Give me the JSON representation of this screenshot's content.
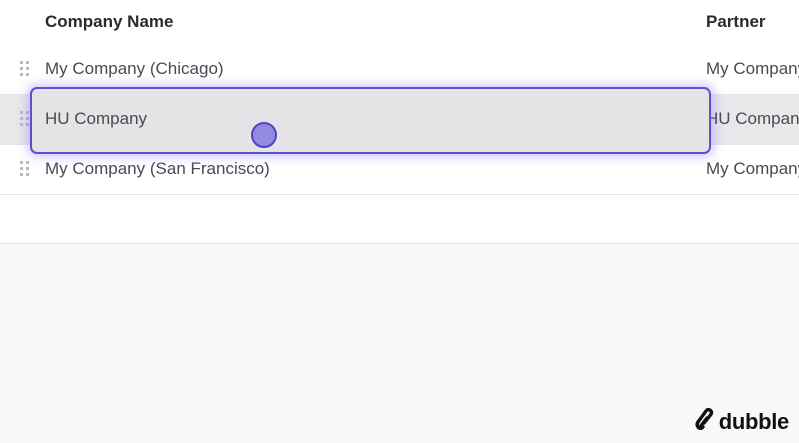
{
  "table": {
    "columns": {
      "company_name": "Company Name",
      "partner": "Partner"
    },
    "rows": [
      {
        "company_name": "My Company (Chicago)",
        "partner": "My Company (Chicago)"
      },
      {
        "company_name": "HU Company",
        "partner": "HU Company"
      },
      {
        "company_name": "My Company (San Francisco)",
        "partner": "My Company (San Francisco)"
      }
    ],
    "dragging_row": {
      "company_name": "HU Company"
    }
  },
  "brand": {
    "logo_text": "dubble",
    "logo_icon": "dubble-logo-icon"
  },
  "colors": {
    "accent": "#5b4fd6",
    "cursor": "#786edc"
  }
}
